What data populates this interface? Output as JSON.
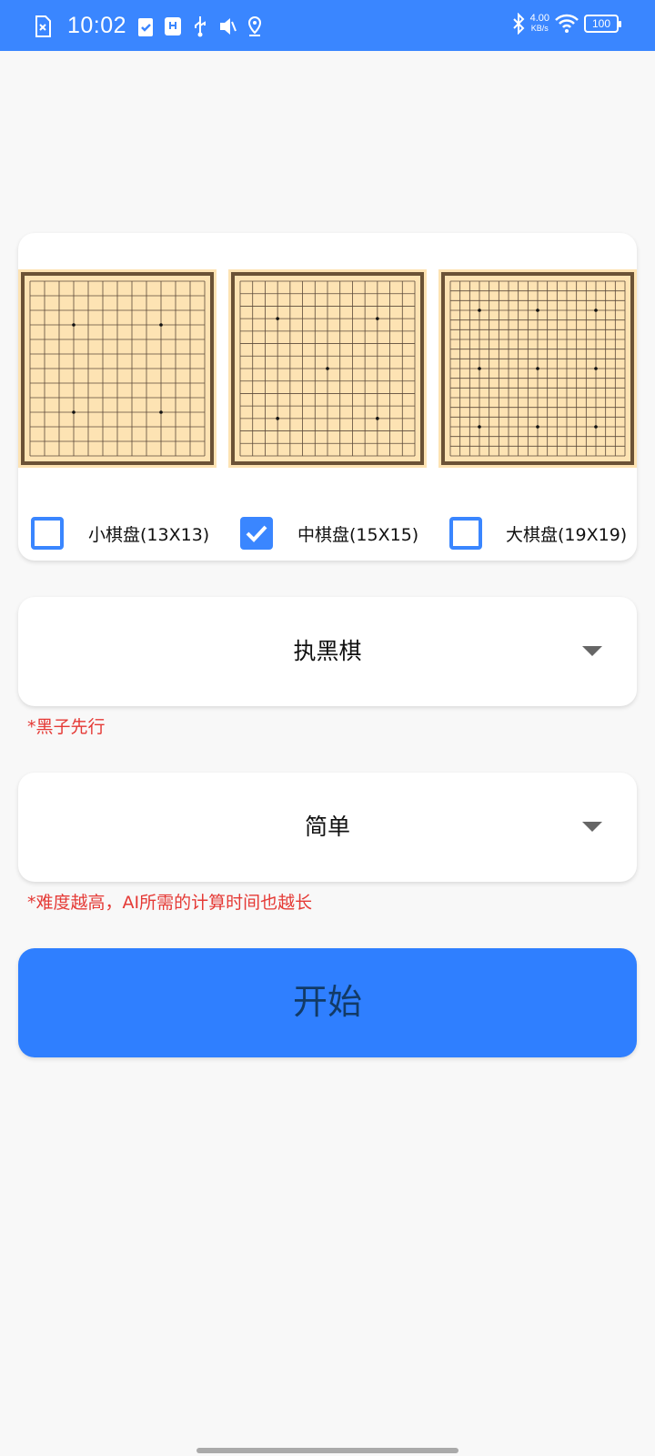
{
  "status_bar": {
    "time": "10:02",
    "net_speed_value": "4.00",
    "net_speed_unit": "KB/s",
    "battery": "100",
    "color": "#3a86ff",
    "left_icons": [
      "sim-error-icon",
      "clipboard-check-icon",
      "usb-debug-icon",
      "usb-icon",
      "mute-icon",
      "location-icon"
    ],
    "right_icons": [
      "bluetooth-icon",
      "wifi-icon",
      "battery-icon"
    ]
  },
  "boards": [
    {
      "label": "小棋盘(13X13)",
      "size": 13,
      "checked": false
    },
    {
      "label": "中棋盘(15X15)",
      "size": 15,
      "checked": true
    },
    {
      "label": "大棋盘(19X19)",
      "size": 19,
      "checked": false
    }
  ],
  "color_select": {
    "value": "执黑棋",
    "hint": "*黑子先行"
  },
  "difficulty_select": {
    "value": "简单",
    "hint": "*难度越高，AI所需的计算时间也越长"
  },
  "start_button": {
    "label": "开始",
    "color": "#2f7fff"
  },
  "accent_color": "#3a86ff",
  "hint_color": "#e53935"
}
